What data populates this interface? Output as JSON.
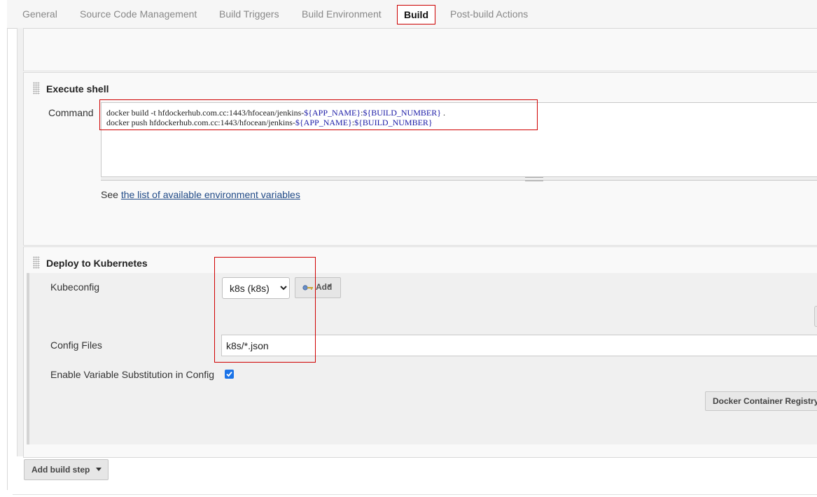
{
  "tabs": [
    {
      "label": "General"
    },
    {
      "label": "Source Code Management"
    },
    {
      "label": "Build Triggers"
    },
    {
      "label": "Build Environment"
    },
    {
      "label": "Build",
      "active": true
    },
    {
      "label": "Post-build Actions"
    }
  ],
  "execute_shell": {
    "title": "Execute shell",
    "command_label": "Command",
    "command_lines": [
      {
        "pre": "docker build -t hfdockerhub.com.cc:1443/hfocean/jenkins-",
        "var1": "${APP_NAME}",
        "mid": ":",
        "var2": "${BUILD_NUMBER}",
        "post": " ."
      },
      {
        "pre": "docker push hfdockerhub.com.cc:1443/hfocean/jenkins-",
        "var1": "${APP_NAME}",
        "mid": ":",
        "var2": "${BUILD_NUMBER}",
        "post": ""
      }
    ],
    "see_prefix": "See ",
    "env_link_text": "the list of available environment variables"
  },
  "deploy_k8s": {
    "title": "Deploy to Kubernetes",
    "kubeconfig_label": "Kubeconfig",
    "kubeconfig_selected": "k8s (k8s)",
    "add_button_label": "Add",
    "config_files_label": "Config Files",
    "config_files_value": "k8s/*.json",
    "enable_var_sub_label": "Enable Variable Substitution in Config",
    "enable_var_sub_checked": true,
    "docker_registry_button": "Docker Container Registry"
  },
  "add_build_step_label": "Add build step",
  "colors": {
    "highlight": "#d00000",
    "link": "#204a87",
    "checkbox": "#1a73e8"
  },
  "icons": [
    "key-icon",
    "dropdown-caret-icon",
    "checkmark-icon",
    "drag-grip-icon"
  ]
}
